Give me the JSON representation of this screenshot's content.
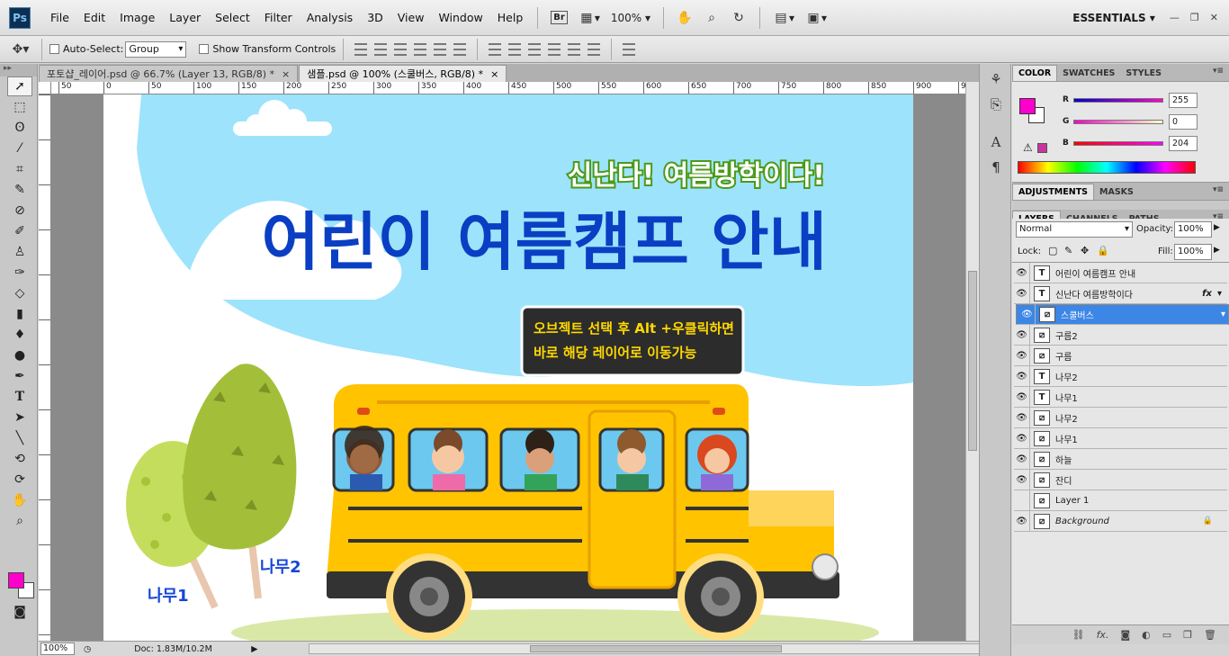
{
  "app": {
    "logo": "Ps",
    "menus": [
      "File",
      "Edit",
      "Image",
      "Layer",
      "Select",
      "Filter",
      "Analysis",
      "3D",
      "View",
      "Window",
      "Help"
    ],
    "bridge": "Br",
    "zoom": "100%",
    "workspace": "ESSENTIALS"
  },
  "options": {
    "auto_select_label": "Auto-Select:",
    "auto_select_value": "Group",
    "show_transform_label": "Show Transform Controls"
  },
  "tabs": [
    {
      "label": "포토샵_레이어.psd @ 66.7% (Layer 13, RGB/8) *",
      "close": "×"
    },
    {
      "label": "샘플.psd @ 100% (스쿨버스, RGB/8) *",
      "close": "×"
    }
  ],
  "ruler_h": [
    "50",
    "0",
    "50",
    "100",
    "150",
    "200",
    "250",
    "300",
    "350",
    "400",
    "450",
    "500",
    "550",
    "600",
    "650",
    "700",
    "750",
    "800",
    "850",
    "900",
    "9"
  ],
  "artwork": {
    "subtitle": "신난다! 여름방학이다!",
    "title": "어린이 여름캠프 안내",
    "tooltip_line1": "오브젝트 선택 후 Alt +우클릭하면",
    "tooltip_line2": "바로 해당 레이어로 이동가능",
    "tree1_label": "나무1",
    "tree2_label": "나무2",
    "colors": {
      "sky": "#9de3fb",
      "title": "#0a3fc4",
      "subtitle": "#ffffff",
      "subtitle_stroke": "#4a9a1a",
      "bus": "#ffc300",
      "tree_dark": "#a3bf3a",
      "tree_light": "#c5dd5c"
    }
  },
  "status": {
    "zoom": "100%",
    "doc": "Doc: 1.83M/10.2M"
  },
  "color_panel": {
    "tabs": [
      "COLOR",
      "SWATCHES",
      "STYLES"
    ],
    "r_label": "R",
    "g_label": "G",
    "b_label": "B",
    "r": "255",
    "g": "0",
    "b": "204",
    "foreground": "#ff00cc"
  },
  "adjust_panel": {
    "tabs": [
      "ADJUSTMENTS",
      "MASKS"
    ]
  },
  "layers_panel": {
    "tabs": [
      "LAYERS",
      "CHANNELS",
      "PATHS"
    ],
    "blend_mode": "Normal",
    "opacity_label": "Opacity:",
    "opacity": "100%",
    "lock_label": "Lock:",
    "fill_label": "Fill:",
    "fill": "100%",
    "layers": [
      {
        "name": "어린이 여름캠프 안내",
        "kind": "T",
        "visible": true
      },
      {
        "name": "신난다 여름방학이다",
        "kind": "T",
        "visible": true,
        "fx": "fx"
      },
      {
        "name": "스쿨버스",
        "kind": "B",
        "visible": true,
        "selected": true
      },
      {
        "name": "구름2",
        "kind": "B",
        "visible": true
      },
      {
        "name": "구름",
        "kind": "B",
        "visible": true
      },
      {
        "name": "나무2",
        "kind": "T",
        "visible": true
      },
      {
        "name": "나무1",
        "kind": "T",
        "visible": true
      },
      {
        "name": "나무2",
        "kind": "B",
        "visible": true
      },
      {
        "name": "나무1",
        "kind": "B",
        "visible": true
      },
      {
        "name": "하늘",
        "kind": "B",
        "visible": true
      },
      {
        "name": "잔디",
        "kind": "B",
        "visible": true
      },
      {
        "name": "Layer 1",
        "kind": "B",
        "visible": false
      },
      {
        "name": "Background",
        "kind": "B",
        "visible": true,
        "locked": true
      }
    ]
  }
}
